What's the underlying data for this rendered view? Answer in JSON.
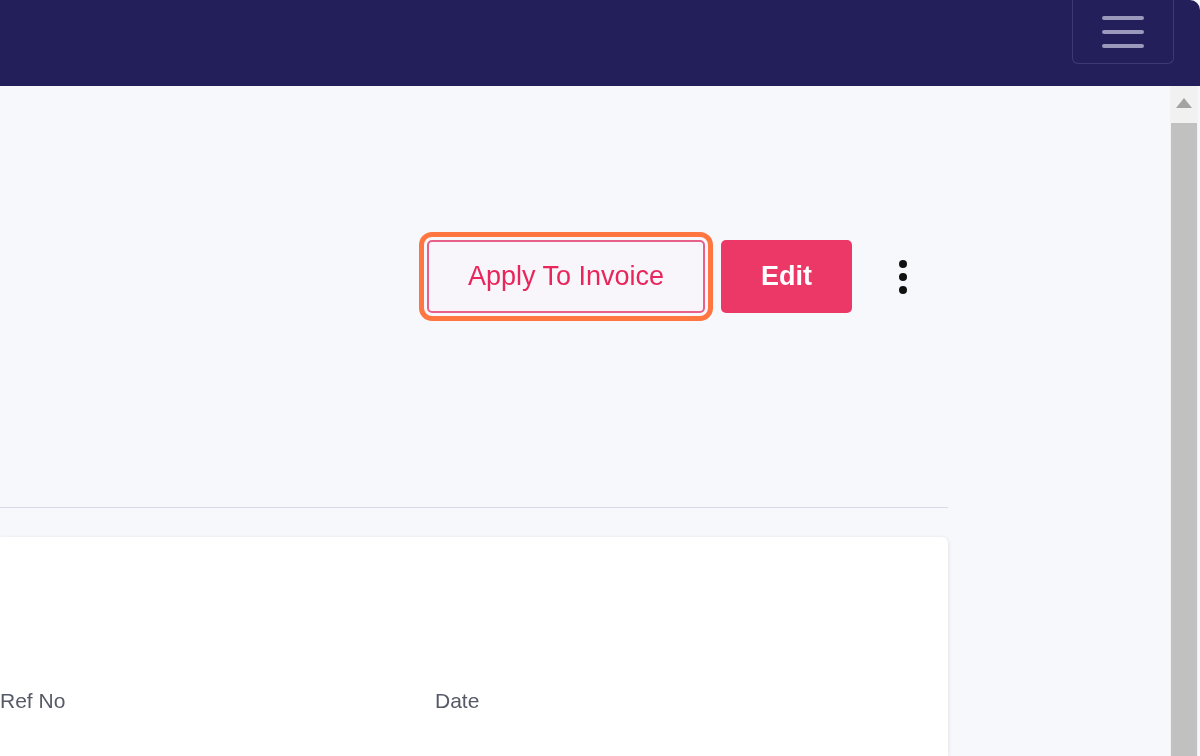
{
  "actions": [
    {
      "label": "Apply To Invoice",
      "kind": "outline",
      "focused": true
    },
    {
      "label": "Edit",
      "kind": "filled",
      "focused": false
    }
  ],
  "card": {
    "fields": [
      {
        "label": "Ref No"
      },
      {
        "label": "Date"
      }
    ]
  }
}
